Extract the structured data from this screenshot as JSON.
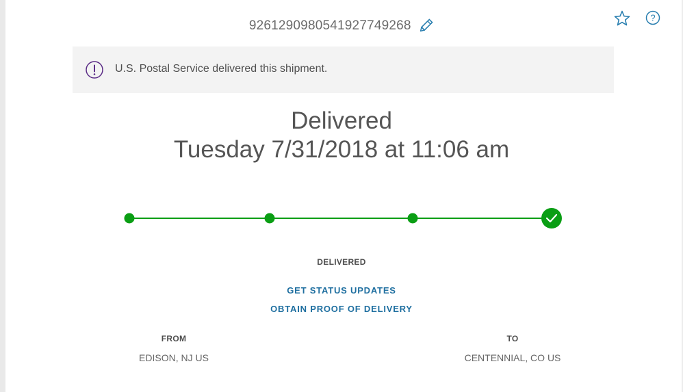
{
  "tracking": {
    "number": "926129098054192774926​8"
  },
  "alert": {
    "message": "U.S. Postal Service delivered this shipment."
  },
  "status": {
    "title": "Delivered",
    "datetime": "Tuesday 7/31/2018 at 11:06 am"
  },
  "progress": {
    "stages_total": 4,
    "current_stage": 4,
    "color": "#0a9e14"
  },
  "stage_label": "DELIVERED",
  "links": {
    "status_updates": "GET STATUS UPDATES",
    "proof_of_delivery": "OBTAIN PROOF OF DELIVERY"
  },
  "from": {
    "heading": "FROM",
    "location": "EDISON, NJ US"
  },
  "to": {
    "heading": "TO",
    "location": "CENTENNIAL, CO US"
  },
  "icons": {
    "edit": "pencil-icon",
    "favorite": "star-icon",
    "help": "question-circle-icon",
    "alert": "exclamation-circle-icon",
    "delivered": "checkmark-icon"
  },
  "colors": {
    "accent": "#1f6fa0",
    "alert_icon": "#5b2c86",
    "success": "#0a9e14"
  }
}
